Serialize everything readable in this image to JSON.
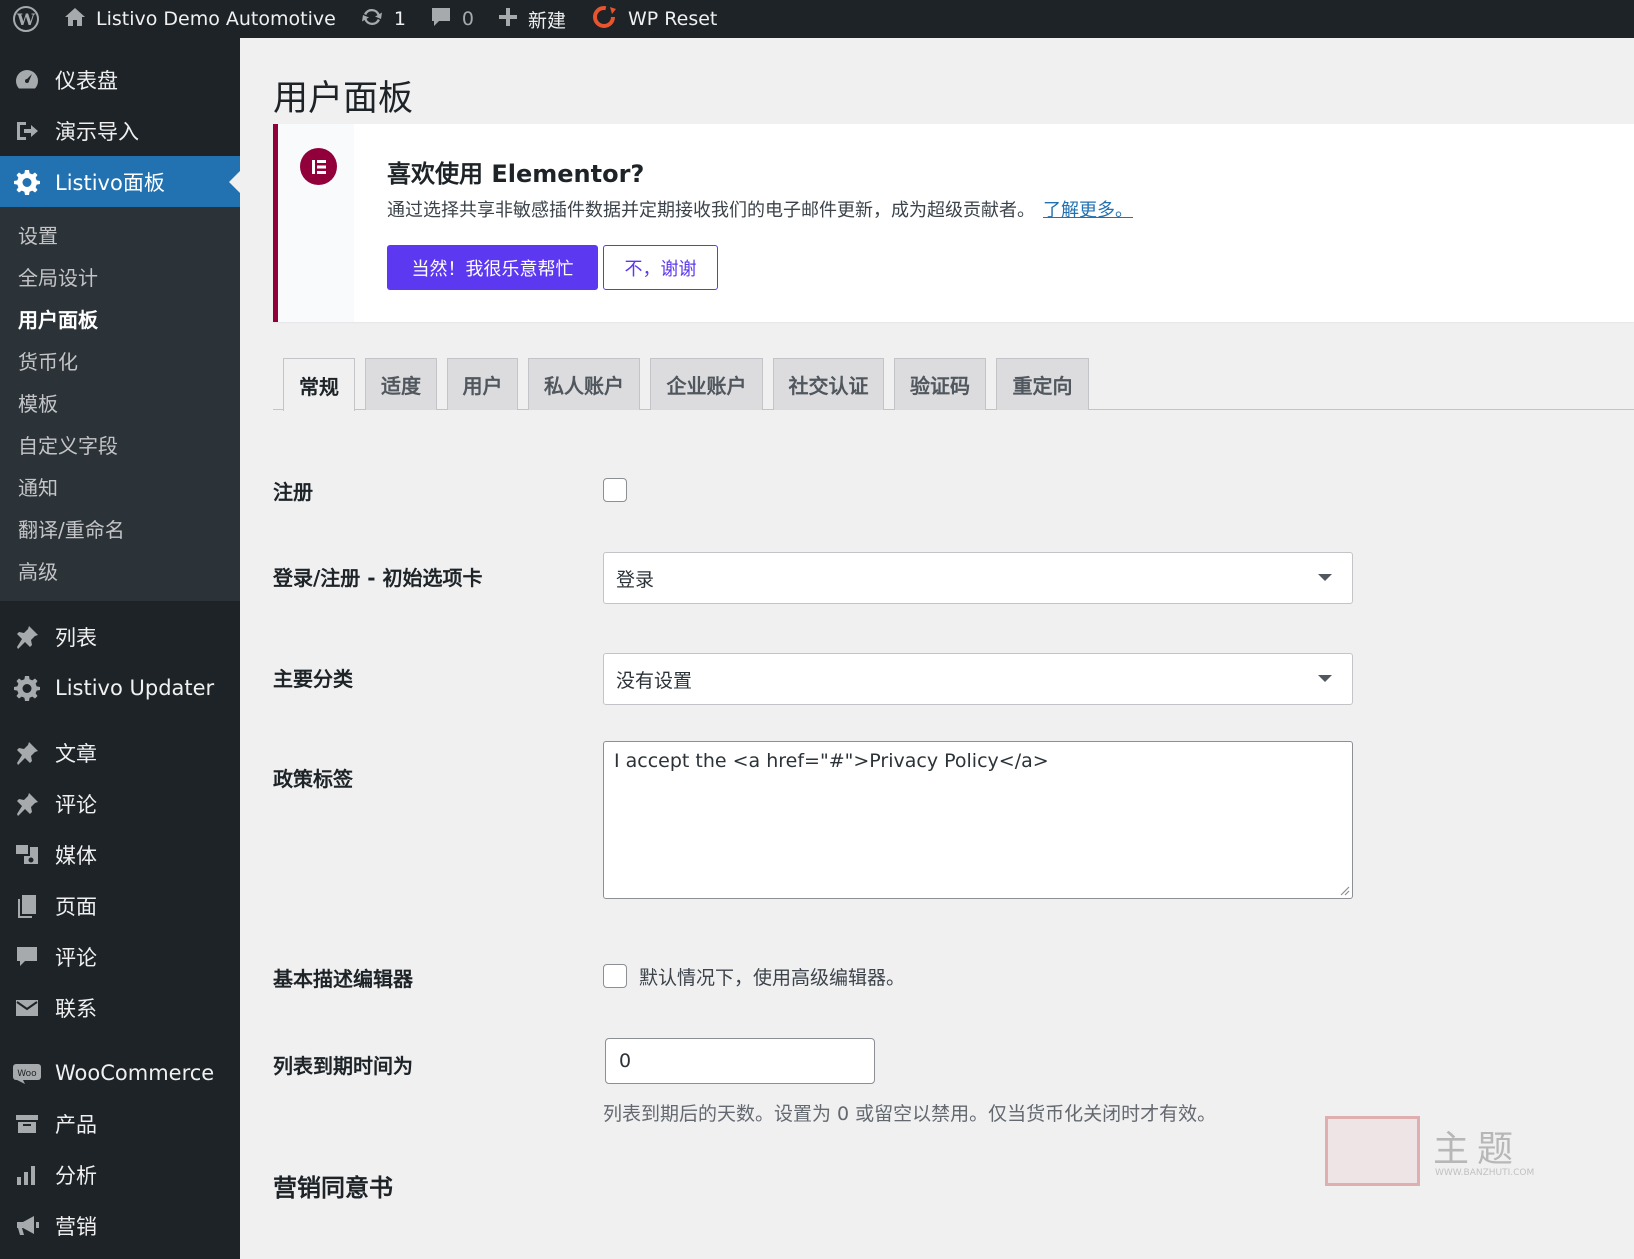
{
  "admin_bar": {
    "site_name": "Listivo Demo Automotive",
    "updates_count": "1",
    "comments_count": "0",
    "new_label": "新建",
    "wp_reset_label": "WP Reset",
    "icons": [
      "wordpress-logo-icon",
      "home-icon",
      "updates-icon",
      "comment-icon",
      "plus-icon",
      "wp-reset-icon"
    ]
  },
  "sidebar": {
    "dashboard": "仪表盘",
    "demo_import": "演示导入",
    "listivo_panel": "Listivo面板",
    "submenu": [
      "设置",
      "全局设计",
      "用户面板",
      "货币化",
      "模板",
      "自定义字段",
      "通知",
      "翻译/重命名",
      "高级"
    ],
    "listings": "列表",
    "listivo_updater": "Listivo Updater",
    "posts": "文章",
    "reviews": "评论",
    "media": "媒体",
    "pages": "页面",
    "comments": "评论",
    "contact": "联系",
    "woocommerce": "WooCommerce",
    "woo_badge": "Woo",
    "products": "产品",
    "analytics": "分析",
    "marketing": "营销"
  },
  "page": {
    "title": "用户面板"
  },
  "notice": {
    "title": "喜欢使用 Elementor?",
    "text": "通过选择共享非敏感插件数据并定期接收我们的电子邮件更新，成为超级贡献者。",
    "link": "了解更多。",
    "accept_button": "当然！我很乐意帮忙",
    "decline_button": "不，谢谢",
    "brand_color": "#92003b",
    "button_color": "#5d38f1"
  },
  "tabs": [
    "常规",
    "适度",
    "用户",
    "私人账户",
    "企业账户",
    "社交认证",
    "验证码",
    "重定向"
  ],
  "form": {
    "registration_label": "注册",
    "registration_checked": false,
    "initial_tab_label": "登录/注册 - 初始选项卡",
    "initial_tab_value": "登录",
    "main_category_label": "主要分类",
    "main_category_value": "没有设置",
    "policy_label": "政策标签",
    "policy_value": "I accept the <a href=\"#\">Privacy Policy</a>",
    "editor_label": "基本描述编辑器",
    "editor_checkbox_label": "默认情况下，使用高级编辑器。",
    "editor_checked": false,
    "expire_label": "列表到期时间为",
    "expire_value": "0",
    "expire_help": "列表到期后的天数。设置为 0 或留空以禁用。仅当货币化关闭时才有效。",
    "marketing_section": "营销同意书"
  },
  "watermark": {
    "text": "主题",
    "url": "WWW.BANZHUTI.COM"
  },
  "colors": {
    "admin_dark": "#1d2327",
    "active_blue": "#2271b1",
    "background": "#f0f0f1"
  }
}
